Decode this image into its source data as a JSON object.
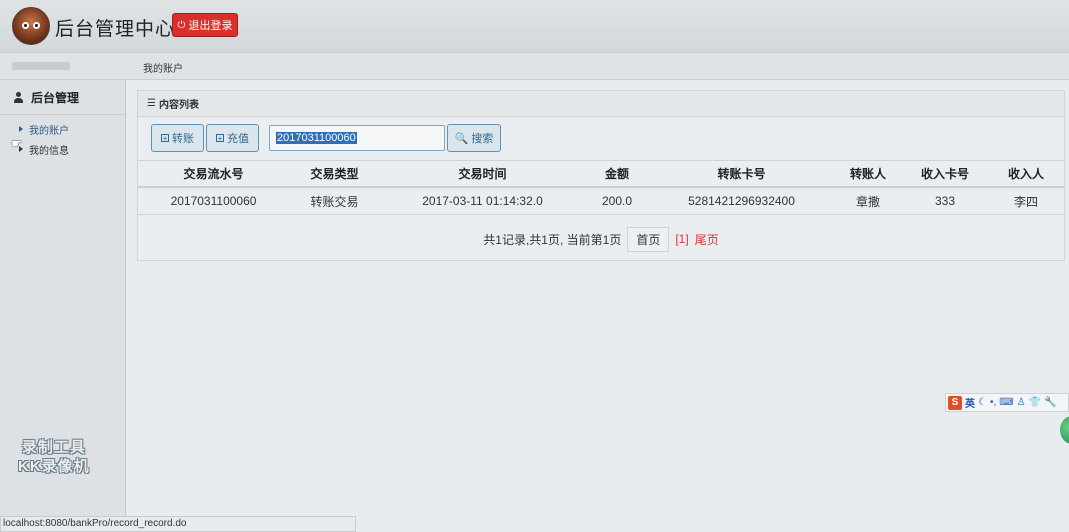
{
  "header": {
    "title": "后台管理中心",
    "logout_label": "退出登录"
  },
  "breadcrumb": {
    "current": "我的账户"
  },
  "sidebar": {
    "section_title": "后台管理",
    "items": [
      {
        "label": "我的账户",
        "active": true
      },
      {
        "label": "我的信息",
        "active": false
      }
    ]
  },
  "panel": {
    "title": "内容列表",
    "toolbar": {
      "transfer_label": "转账",
      "recharge_label": "充值",
      "search_value": "2017031100060",
      "search_label": "搜索"
    },
    "table": {
      "columns": [
        "交易流水号",
        "交易类型",
        "交易时间",
        "金额",
        "转账卡号",
        "转账人",
        "收入卡号",
        "收入人"
      ],
      "rows": [
        [
          "2017031100060",
          "转账交易",
          "2017-03-11 01:14:32.0",
          "200.0",
          "5281421296932400",
          "章撒",
          "333",
          "李四"
        ]
      ]
    },
    "pager": {
      "summary": "共1记录,共1页, 当前第1页",
      "first_label": "首页",
      "page_marker": "[1]",
      "last_label": "尾页"
    }
  },
  "watermark": {
    "line1": "录制工具",
    "line2": "KK录像机"
  },
  "ime": {
    "lang": "英"
  },
  "status_url": "localhost:8080/bankPro/record_record.do",
  "colors": {
    "logout_bg": "#d9302b",
    "accent": "#2e6a92",
    "pager_red": "#dd3333"
  }
}
